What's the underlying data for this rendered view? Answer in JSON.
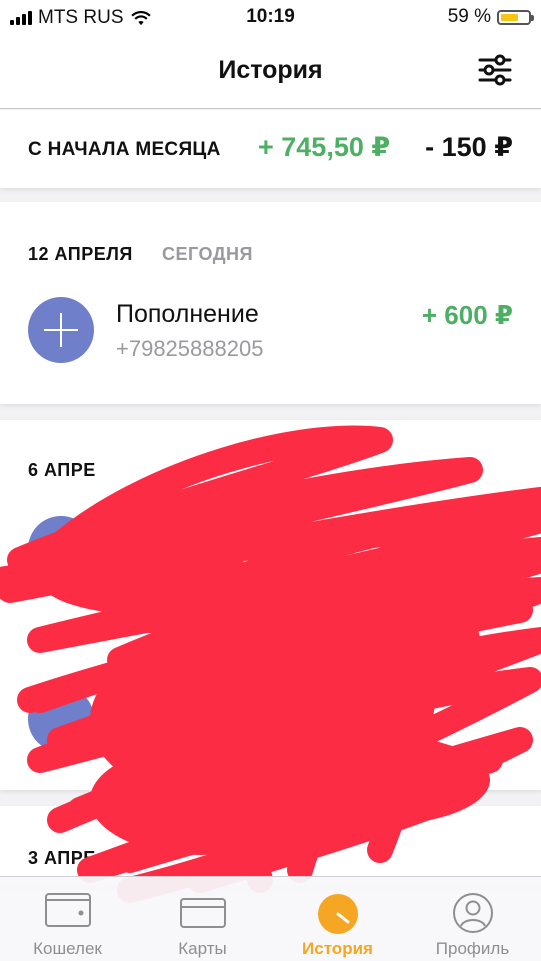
{
  "status_bar": {
    "carrier": "MTS RUS",
    "time": "10:19",
    "battery_percent": "59 %",
    "battery_level": 0.59
  },
  "nav": {
    "title": "История",
    "filter_icon": "sliders-icon"
  },
  "summary": {
    "label": "С НАЧАЛА МЕСЯЦА",
    "income": "+ 745,50 ₽",
    "expense": "- 150 ₽"
  },
  "days": [
    {
      "date": "12 АПРЕЛЯ",
      "relative": "СЕГОДНЯ",
      "transactions": [
        {
          "title": "Пополнение",
          "subtitle": "+79825888205",
          "amount": "+ 600 ₽",
          "icon": "plus-icon"
        }
      ]
    },
    {
      "date": "6 АПРЕ"
    },
    {
      "date": "3 АПРЕ"
    }
  ],
  "tabs": [
    {
      "label": "Кошелек",
      "icon": "wallet-icon",
      "active": false
    },
    {
      "label": "Карты",
      "icon": "cards-icon",
      "active": false
    },
    {
      "label": "История",
      "icon": "history-icon",
      "active": true
    },
    {
      "label": "Профиль",
      "icon": "profile-icon",
      "active": false
    }
  ],
  "colors": {
    "income_green": "#4caf64",
    "accent_orange": "#f5a623",
    "icon_blue": "#6f7fc9",
    "scribble_red": "#fc2c44"
  }
}
